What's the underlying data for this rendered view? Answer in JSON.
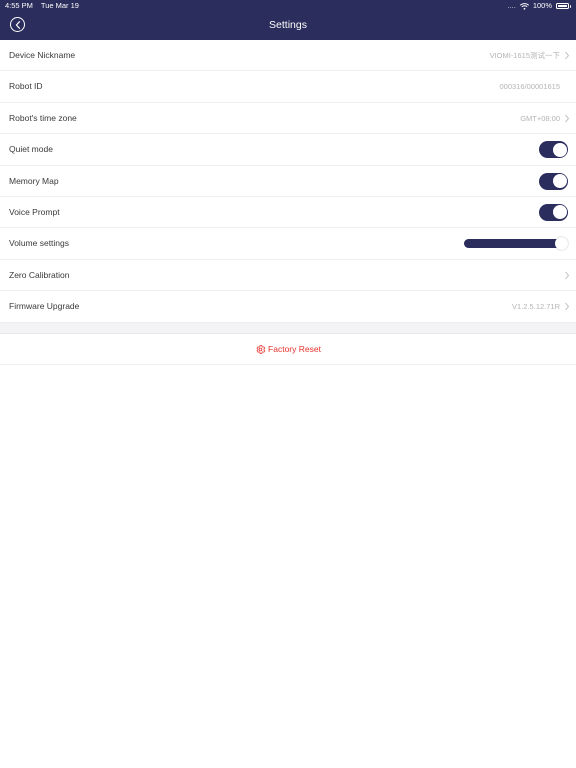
{
  "status_bar": {
    "time": "4:55 PM",
    "date": "Tue Mar 19",
    "signal_dots": "....",
    "battery": "100%",
    "battery_level": 1.0
  },
  "header": {
    "title": "Settings",
    "back_icon": "back-circle-icon"
  },
  "rows": {
    "device_nickname": {
      "label": "Device Nickname",
      "value": "VIOMI-1615测试一下"
    },
    "robot_id": {
      "label": "Robot ID",
      "value": "000316/00001615"
    },
    "time_zone": {
      "label": "Robot's time zone",
      "value": "GMT+08:00"
    },
    "quiet_mode": {
      "label": "Quiet mode",
      "on": true
    },
    "memory_map": {
      "label": "Memory Map",
      "on": true
    },
    "voice_prompt": {
      "label": "Voice Prompt",
      "on": true
    },
    "volume": {
      "label": "Volume settings",
      "level": 0.94
    },
    "zero_calibration": {
      "label": "Zero Calibration"
    },
    "firmware": {
      "label": "Firmware Upgrade",
      "value": "V1.2.5.12.71R"
    }
  },
  "factory_reset": {
    "label": "Factory Reset",
    "icon": "gear-icon",
    "color": "#e5322d"
  },
  "colors": {
    "header_bg": "#2b2d5c",
    "accent": "#2b2d5c",
    "danger": "#e5322d"
  }
}
